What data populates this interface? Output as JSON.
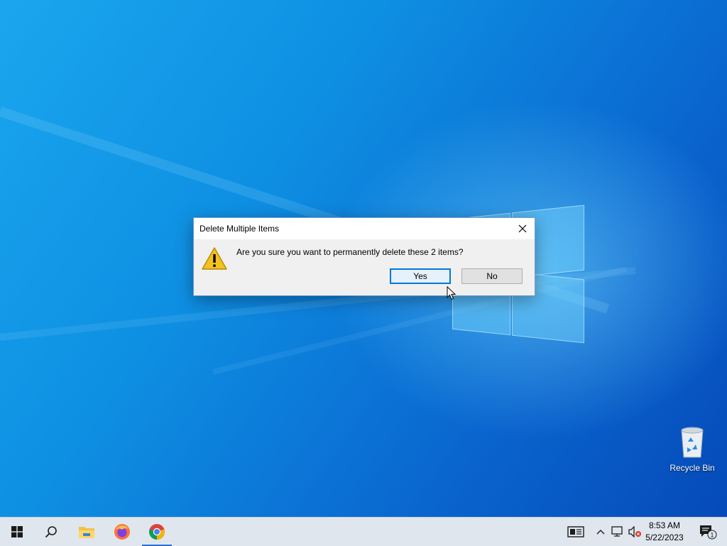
{
  "desktop": {
    "icons": [
      {
        "label": "Recycle Bin",
        "icon": "recycle-bin-icon"
      }
    ]
  },
  "dialog": {
    "title": "Delete Multiple Items",
    "message": "Are you sure you want to permanently delete these 2 items?",
    "buttons": {
      "yes": "Yes",
      "no": "No"
    },
    "icon": "warning-icon"
  },
  "taskbar": {
    "pinned": [
      "start-icon",
      "search-icon",
      "file-explorer-icon",
      "firefox-icon",
      "chrome-icon"
    ],
    "active": "chrome-icon",
    "tray": [
      "news-widget-icon",
      "chevron-up-icon",
      "network-icon",
      "volume-muted-icon"
    ],
    "time": "8:53 AM",
    "date": "5/22/2023",
    "notifications_count": "1"
  },
  "colors": {
    "accent": "#0078d7",
    "desktop_blue": "#0e8fe2",
    "taskbar_bg": "#dfe6ee"
  }
}
